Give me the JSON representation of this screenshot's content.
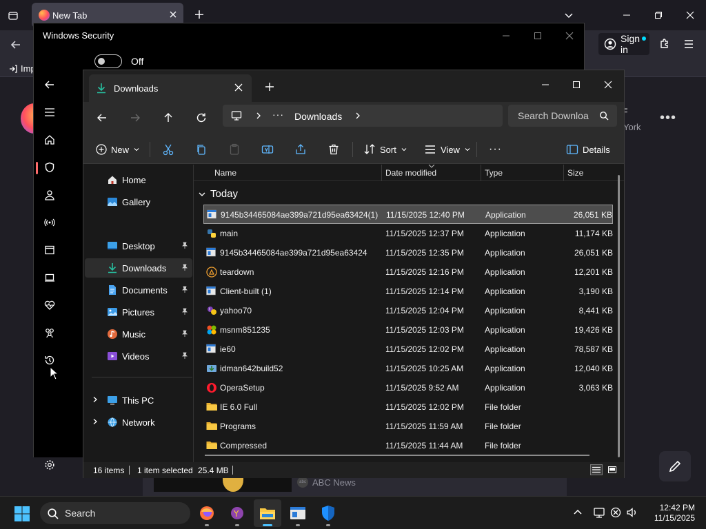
{
  "browser": {
    "tab_title": "New Tab",
    "signin_label": "Sign in",
    "bookmark_partial": "Imp",
    "weather_unit": "F",
    "weather_city": "York",
    "news_source": "ABC News"
  },
  "security": {
    "title": "Windows Security",
    "toggle_label": "Off"
  },
  "explorer": {
    "tab_title": "Downloads",
    "breadcrumb_overflow": "···",
    "breadcrumb": "Downloads",
    "search_placeholder": "Search Downloa",
    "commands": {
      "new": "New",
      "sort": "Sort",
      "view": "View",
      "more": "···",
      "details": "Details"
    },
    "nav": [
      {
        "label": "Home",
        "icon": "home-icon",
        "pinned": false
      },
      {
        "label": "Gallery",
        "icon": "gallery-icon",
        "pinned": false
      },
      {
        "label": "Desktop",
        "icon": "desktop-icon",
        "pinned": true
      },
      {
        "label": "Downloads",
        "icon": "download-icon",
        "pinned": true,
        "selected": true
      },
      {
        "label": "Documents",
        "icon": "documents-icon",
        "pinned": true
      },
      {
        "label": "Pictures",
        "icon": "pictures-icon",
        "pinned": true
      },
      {
        "label": "Music",
        "icon": "music-icon",
        "pinned": true
      },
      {
        "label": "Videos",
        "icon": "videos-icon",
        "pinned": true
      },
      {
        "label": "This PC",
        "icon": "this-pc-icon",
        "expandable": true
      },
      {
        "label": "Network",
        "icon": "network-icon",
        "expandable": true
      }
    ],
    "columns": {
      "name": "Name",
      "date": "Date modified",
      "type": "Type",
      "size": "Size"
    },
    "group_label": "Today",
    "files": [
      {
        "name": "9145b34465084ae399a721d95ea63424(1)",
        "date": "11/15/2025 12:40 PM",
        "type": "Application",
        "size": "26,051 KB",
        "icon": "app-window-icon",
        "selected": true
      },
      {
        "name": "main",
        "date": "11/15/2025 12:37 PM",
        "type": "Application",
        "size": "11,174 KB",
        "icon": "python-icon"
      },
      {
        "name": "9145b34465084ae399a721d95ea63424",
        "date": "11/15/2025 12:35 PM",
        "type": "Application",
        "size": "26,051 KB",
        "icon": "app-window-icon"
      },
      {
        "name": "teardown",
        "date": "11/15/2025 12:16 PM",
        "type": "Application",
        "size": "12,201 KB",
        "icon": "teardown-icon"
      },
      {
        "name": "Client-built (1)",
        "date": "11/15/2025 12:14 PM",
        "type": "Application",
        "size": "3,190 KB",
        "icon": "app-window-icon"
      },
      {
        "name": "yahoo70",
        "date": "11/15/2025 12:04 PM",
        "type": "Application",
        "size": "8,441 KB",
        "icon": "yahoo-icon"
      },
      {
        "name": "msnm851235",
        "date": "11/15/2025 12:03 PM",
        "type": "Application",
        "size": "19,426 KB",
        "icon": "msn-icon"
      },
      {
        "name": "ie60",
        "date": "11/15/2025 12:02 PM",
        "type": "Application",
        "size": "78,587 KB",
        "icon": "app-window-icon"
      },
      {
        "name": "idman642build52",
        "date": "11/15/2025 10:25 AM",
        "type": "Application",
        "size": "12,040 KB",
        "icon": "idm-icon"
      },
      {
        "name": "OperaSetup",
        "date": "11/15/2025 9:52 AM",
        "type": "Application",
        "size": "3,063 KB",
        "icon": "opera-icon"
      },
      {
        "name": "IE 6.0 Full",
        "date": "11/15/2025 12:02 PM",
        "type": "File folder",
        "size": "",
        "icon": "folder-icon"
      },
      {
        "name": "Programs",
        "date": "11/15/2025 11:59 AM",
        "type": "File folder",
        "size": "",
        "icon": "folder-icon"
      },
      {
        "name": "Compressed",
        "date": "11/15/2025 11:44 AM",
        "type": "File folder",
        "size": "",
        "icon": "folder-icon"
      }
    ],
    "status": {
      "item_count": "16 items",
      "selection": "1 item selected",
      "selection_size": "25.4 MB"
    }
  },
  "taskbar": {
    "search_label": "Search",
    "time": "12:42 PM",
    "date": "11/15/2025"
  },
  "colors": {
    "accent": "#4cc2ff",
    "download_green": "#27c0a0",
    "folder_yellow": "#f8c843"
  }
}
